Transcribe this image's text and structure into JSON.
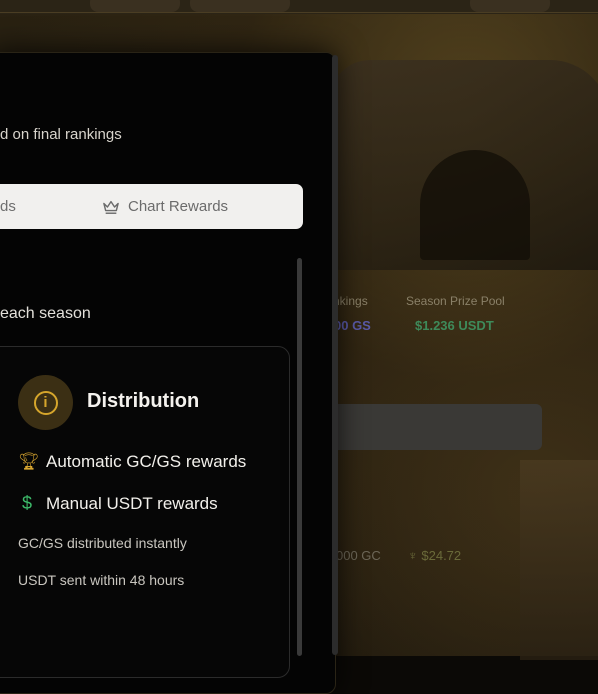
{
  "modal": {
    "subtitle": "d on final rankings",
    "tabs": {
      "left_label": "ds",
      "right_label": "Chart Rewards",
      "right_icon": "crown-icon"
    },
    "season_text": "each season",
    "card": {
      "title": "Distribution",
      "icon": "info-icon",
      "items": [
        {
          "icon": "trophy-icon",
          "label": "Automatic GC/GS rewards"
        },
        {
          "icon": "dollar-icon",
          "label": "Manual USDT rewards"
        }
      ],
      "notes": [
        "GC/GS distributed instantly",
        "USDT sent within 48 hours"
      ]
    }
  },
  "background": {
    "stat_label_1": "nkings",
    "stat_label_2": "Season Prize Pool",
    "stat_value_1": "00 GS",
    "stat_value_2": "$1.236 USDT",
    "gc_value": "000 GC",
    "usdt_value": "$24.72"
  },
  "colors": {
    "accent_gold": "#d6a62c",
    "accent_green": "#3dbb6a",
    "panel_bg": "#040404",
    "tab_bg": "#f1f0ee"
  }
}
